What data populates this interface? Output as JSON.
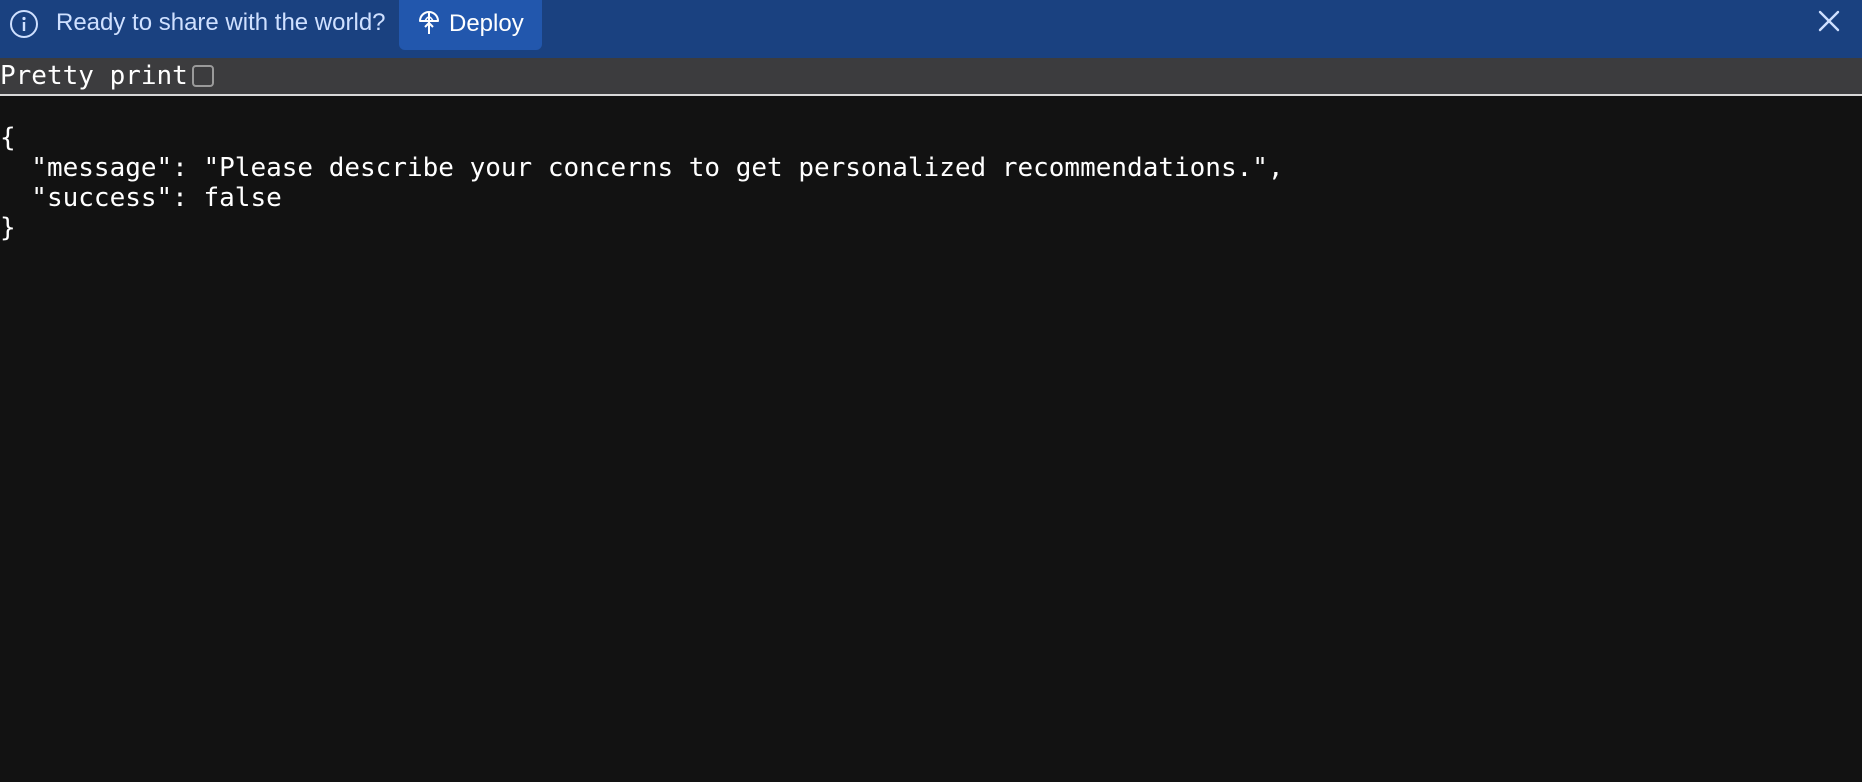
{
  "banner": {
    "message": "Ready to share with the world?",
    "deploy_label": "Deploy",
    "info_icon": "info-circle-icon",
    "deploy_icon": "deploy-icon",
    "close_icon": "close-x-icon",
    "colors": {
      "background": "#1a4180",
      "deploy_button": "#2257ad",
      "text": "#cfe0ff"
    }
  },
  "toolbar": {
    "pretty_print_label": "Pretty print",
    "pretty_print_checked": false
  },
  "json_view": {
    "open_brace": "{",
    "lines": [
      "  \"message\": \"Please describe your concerns to get personalized recommendations.\",",
      "  \"success\": false"
    ],
    "close_brace": "}"
  }
}
